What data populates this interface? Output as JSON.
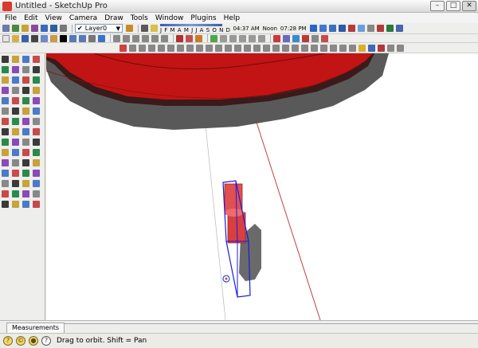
{
  "window": {
    "title": "Untitled - SketchUp Pro"
  },
  "menu": [
    "File",
    "Edit",
    "View",
    "Camera",
    "Draw",
    "Tools",
    "Window",
    "Plugins",
    "Help"
  ],
  "toolbar": {
    "layer": {
      "name": "Layer0"
    },
    "months": "J F M A M J J A S O N D",
    "time_start": "04:37 AM",
    "noon": "Noon",
    "time_end": "07:28 PM"
  },
  "measurements": {
    "label": "Measurements",
    "value": ""
  },
  "status": {
    "text": "Drag to orbit.  Shift = Pan"
  },
  "colors": {
    "accent_red": "#d01010",
    "shadow": "#555555",
    "selection_blue": "#1a1ae0",
    "axis_red": "#c04040"
  }
}
